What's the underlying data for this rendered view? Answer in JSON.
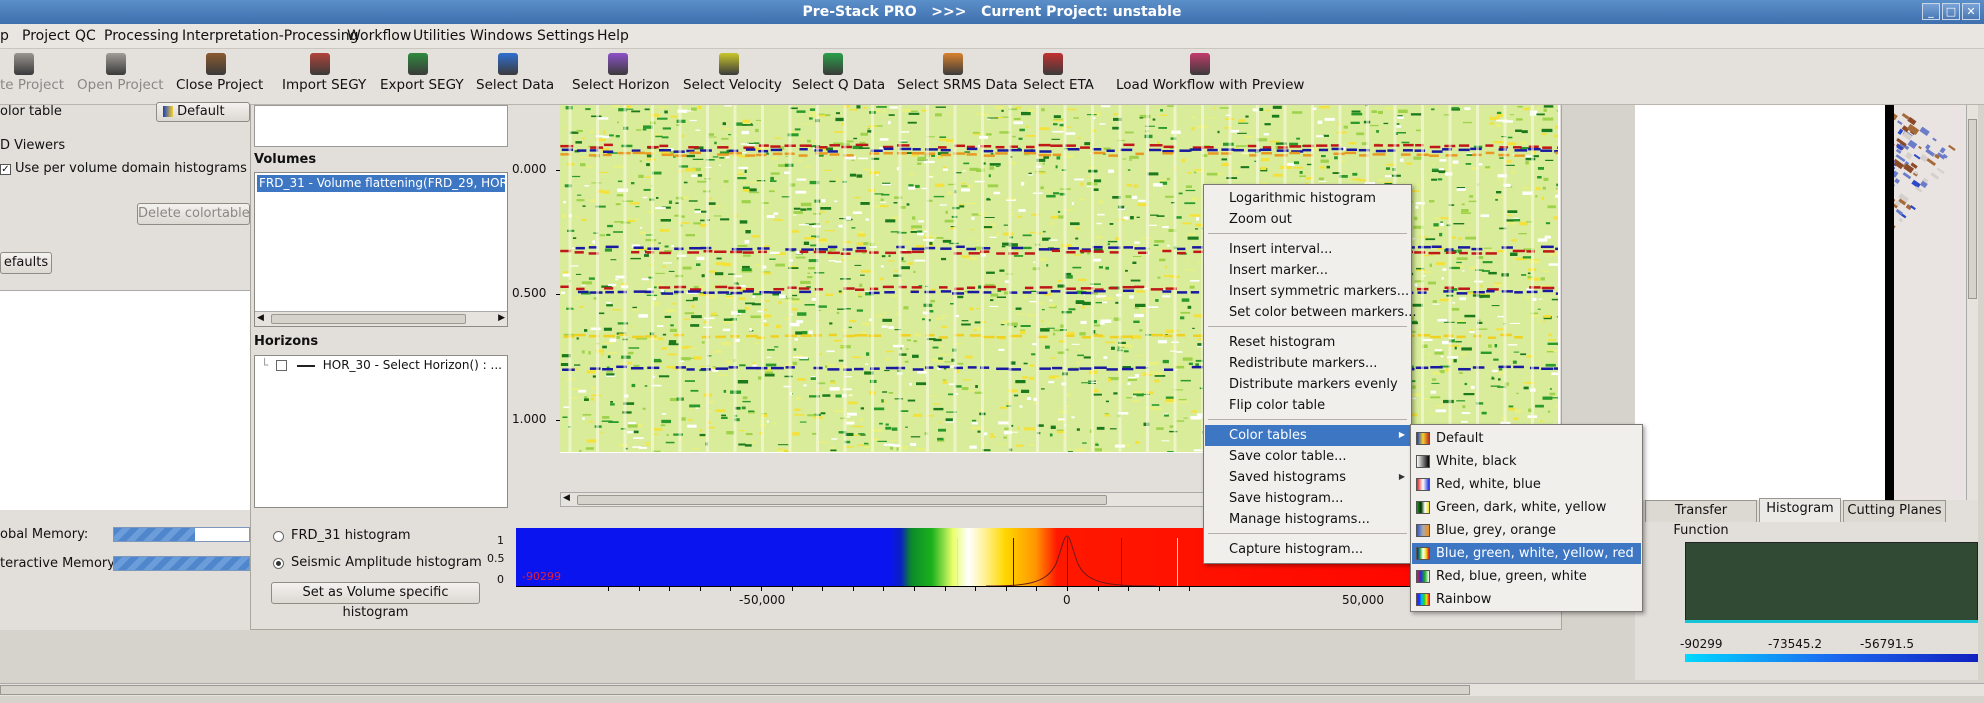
{
  "window": {
    "title": "Pre-Stack PRO   >>>   Current Project: unstable",
    "buttons": [
      "_",
      "□",
      "✕"
    ]
  },
  "menubar": [
    "p",
    "Project",
    "QC",
    "Processing",
    "Interpretation-Processing",
    "Workflow",
    "Utilities",
    "Windows",
    "Settings",
    "Help"
  ],
  "toolbar": [
    {
      "label": "te Project",
      "icon": "delete-project-icon",
      "color": "#9a9590",
      "disabled": true
    },
    {
      "label": "Open Project",
      "icon": "open-project-icon",
      "color": "#a19d98",
      "disabled": true
    },
    {
      "label": "Close Project",
      "icon": "close-project-icon",
      "color": "#8a5a2e",
      "disabled": false
    },
    {
      "label": "Import SEGY",
      "icon": "import-segy-icon",
      "color": "#b1443a",
      "disabled": false
    },
    {
      "label": "Export SEGY",
      "icon": "export-segy-icon",
      "color": "#2f8a3e",
      "disabled": false
    },
    {
      "label": "Select Data",
      "icon": "select-data-icon",
      "color": "#2f6fd0",
      "disabled": false
    },
    {
      "label": "Select Horizon",
      "icon": "select-horizon-icon",
      "color": "#8d52c8",
      "disabled": false
    },
    {
      "label": "Select Velocity",
      "icon": "select-velocity-icon",
      "color": "#c9c62a",
      "disabled": false
    },
    {
      "label": "Select Q Data",
      "icon": "select-q-data-icon",
      "color": "#2aa04a",
      "disabled": false
    },
    {
      "label": "Select SRMS Data",
      "icon": "select-srms-data-icon",
      "color": "#d9822e",
      "disabled": false
    },
    {
      "label": "Select ETA",
      "icon": "select-eta-icon",
      "color": "#c23030",
      "disabled": false
    },
    {
      "label": "Load Workflow with Preview",
      "icon": "load-workflow-icon",
      "color": "#c23a6a",
      "disabled": false
    }
  ],
  "left_panel": {
    "color_table_label": "olor table",
    "color_table_value": "Default",
    "viewers_label": "D Viewers",
    "histogram_checkbox": "Use per volume domain histograms by",
    "delete_button": "Delete colortables",
    "defaults_button": "efaults",
    "global_memory": "obal Memory:",
    "interactive_memory": "teractive Memory:",
    "global_memory_fraction": 0.6
  },
  "volumes": {
    "label": "Volumes",
    "items": [
      "FRD_31 - Volume flattening(FRD_29, HOR"
    ]
  },
  "horizons": {
    "label": "Horizons",
    "items": [
      "HOR_30 - Select Horizon() : ..."
    ]
  },
  "seismic": {
    "y_ticks": [
      "0.000",
      "0.500",
      "1.000"
    ]
  },
  "histogram_controls": {
    "radio1": "FRD_31 histogram",
    "radio2": "Seismic Amplitude histogram",
    "button": "Set as Volume specific histogram",
    "y_ticks": [
      "1",
      "0.5",
      "0"
    ],
    "min_label": "-90299",
    "x_ticks": [
      "-50,000",
      "0",
      "50,000"
    ]
  },
  "context_menu": {
    "items": [
      "Logarithmic histogram",
      "Zoom out",
      "Insert interval...",
      "Insert marker...",
      "Insert symmetric markers...",
      "Set color between markers...",
      "Reset histogram",
      "Redistribute markers...",
      "Distribute markers evenly",
      "Flip color table",
      "Color tables",
      "Save color table...",
      "Saved histograms",
      "Save histogram...",
      "Manage histograms...",
      "Capture histogram..."
    ],
    "selected": "Color tables"
  },
  "submenu": {
    "items": [
      "Default",
      "White, black",
      "Red, white, blue",
      "Green, dark, white, yellow",
      "Blue, grey, orange",
      "Blue, green, white, yellow, red",
      "Red, blue, green, white",
      "Rainbow"
    ],
    "selected": "Blue, green, white, yellow, red"
  },
  "right_panel": {
    "tabs": [
      "Transfer Function",
      "Histogram",
      "Cutting Planes"
    ],
    "active_tab": "Histogram",
    "x_ticks": [
      "-90299",
      "-73545.2",
      "-56791.5"
    ]
  }
}
